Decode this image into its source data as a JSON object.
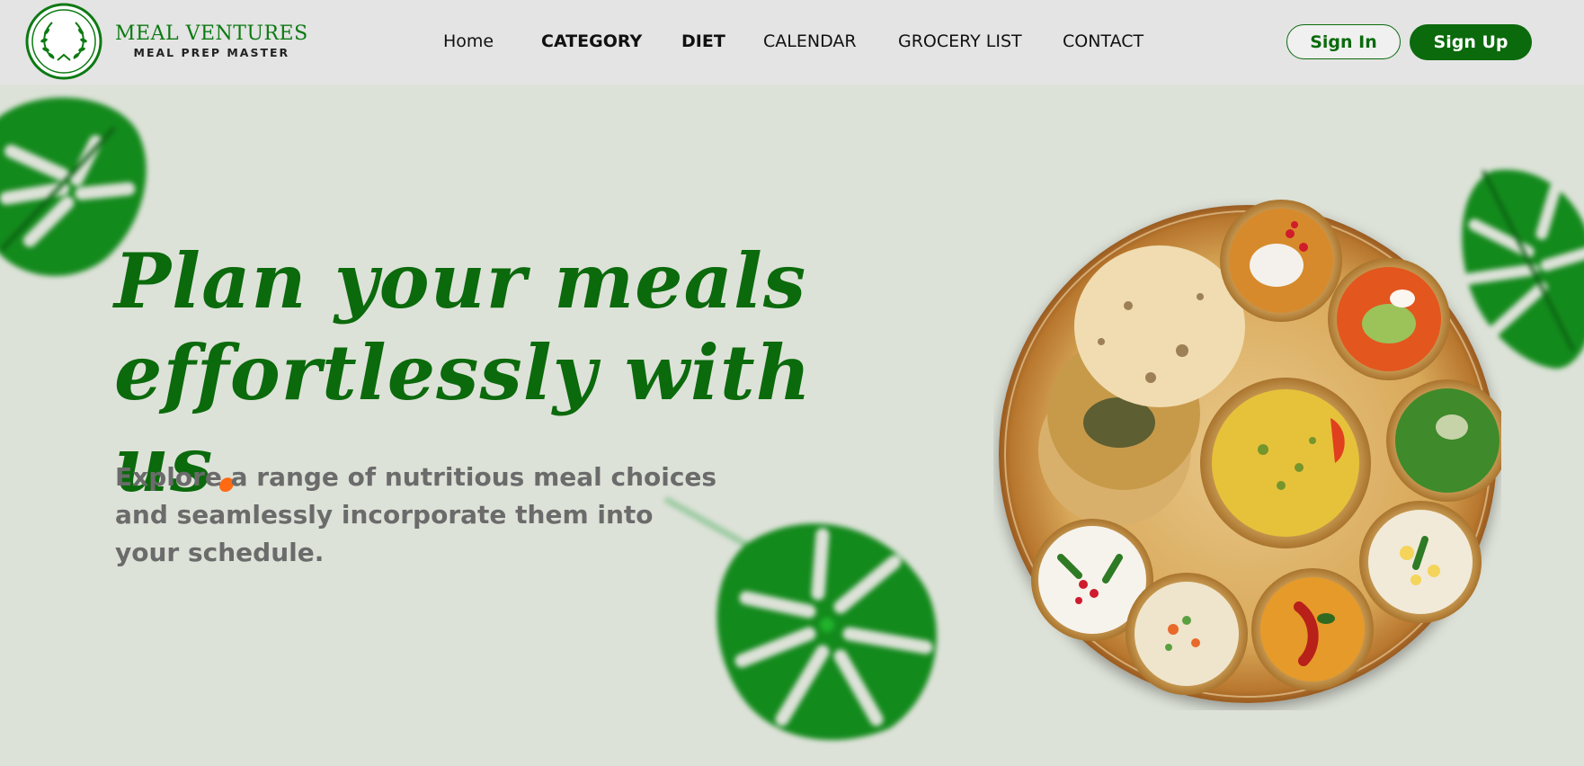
{
  "brand": {
    "title": "MEAL VENTURES",
    "subtitle": "MEAL PREP MASTER",
    "logo_icon": "laurel-wreath-icon",
    "color": "#0c7a12"
  },
  "nav": {
    "items": [
      {
        "label": "Home"
      },
      {
        "label": "CATEGORY"
      },
      {
        "label": "DIET"
      },
      {
        "label": "CALENDAR"
      },
      {
        "label": "GROCERY LIST"
      },
      {
        "label": "CONTACT"
      }
    ]
  },
  "auth": {
    "sign_in": "Sign In",
    "sign_up": "Sign Up"
  },
  "hero": {
    "title_line1": "Plan your meals",
    "title_line2": "effortlessly with us",
    "title_dot": ".",
    "description": "Explore a range of nutritious meal choices and seamlessly incorporate them into your schedule."
  },
  "colors": {
    "primary_green": "#0b6a0c",
    "accent_orange": "#ff6a13",
    "header_bg": "#e4e4e4",
    "page_bg": "#dde2d8",
    "text_gray": "#6b6b6b"
  },
  "images": {
    "hero_image": "indian-thali-plate",
    "decorations": [
      "monstera-leaf-icon",
      "monstera-leaf-icon",
      "monstera-leaf-icon"
    ]
  }
}
